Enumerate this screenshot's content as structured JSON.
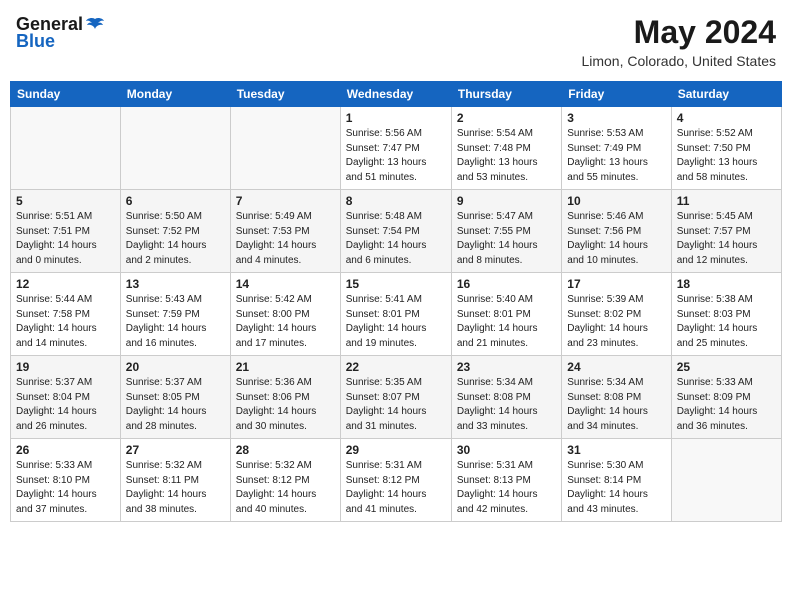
{
  "header": {
    "logo_general": "General",
    "logo_blue": "Blue",
    "title": "May 2024",
    "subtitle": "Limon, Colorado, United States"
  },
  "days_of_week": [
    "Sunday",
    "Monday",
    "Tuesday",
    "Wednesday",
    "Thursday",
    "Friday",
    "Saturday"
  ],
  "weeks": [
    [
      {
        "day": "",
        "info": ""
      },
      {
        "day": "",
        "info": ""
      },
      {
        "day": "",
        "info": ""
      },
      {
        "day": "1",
        "info": "Sunrise: 5:56 AM\nSunset: 7:47 PM\nDaylight: 13 hours\nand 51 minutes."
      },
      {
        "day": "2",
        "info": "Sunrise: 5:54 AM\nSunset: 7:48 PM\nDaylight: 13 hours\nand 53 minutes."
      },
      {
        "day": "3",
        "info": "Sunrise: 5:53 AM\nSunset: 7:49 PM\nDaylight: 13 hours\nand 55 minutes."
      },
      {
        "day": "4",
        "info": "Sunrise: 5:52 AM\nSunset: 7:50 PM\nDaylight: 13 hours\nand 58 minutes."
      }
    ],
    [
      {
        "day": "5",
        "info": "Sunrise: 5:51 AM\nSunset: 7:51 PM\nDaylight: 14 hours\nand 0 minutes."
      },
      {
        "day": "6",
        "info": "Sunrise: 5:50 AM\nSunset: 7:52 PM\nDaylight: 14 hours\nand 2 minutes."
      },
      {
        "day": "7",
        "info": "Sunrise: 5:49 AM\nSunset: 7:53 PM\nDaylight: 14 hours\nand 4 minutes."
      },
      {
        "day": "8",
        "info": "Sunrise: 5:48 AM\nSunset: 7:54 PM\nDaylight: 14 hours\nand 6 minutes."
      },
      {
        "day": "9",
        "info": "Sunrise: 5:47 AM\nSunset: 7:55 PM\nDaylight: 14 hours\nand 8 minutes."
      },
      {
        "day": "10",
        "info": "Sunrise: 5:46 AM\nSunset: 7:56 PM\nDaylight: 14 hours\nand 10 minutes."
      },
      {
        "day": "11",
        "info": "Sunrise: 5:45 AM\nSunset: 7:57 PM\nDaylight: 14 hours\nand 12 minutes."
      }
    ],
    [
      {
        "day": "12",
        "info": "Sunrise: 5:44 AM\nSunset: 7:58 PM\nDaylight: 14 hours\nand 14 minutes."
      },
      {
        "day": "13",
        "info": "Sunrise: 5:43 AM\nSunset: 7:59 PM\nDaylight: 14 hours\nand 16 minutes."
      },
      {
        "day": "14",
        "info": "Sunrise: 5:42 AM\nSunset: 8:00 PM\nDaylight: 14 hours\nand 17 minutes."
      },
      {
        "day": "15",
        "info": "Sunrise: 5:41 AM\nSunset: 8:01 PM\nDaylight: 14 hours\nand 19 minutes."
      },
      {
        "day": "16",
        "info": "Sunrise: 5:40 AM\nSunset: 8:01 PM\nDaylight: 14 hours\nand 21 minutes."
      },
      {
        "day": "17",
        "info": "Sunrise: 5:39 AM\nSunset: 8:02 PM\nDaylight: 14 hours\nand 23 minutes."
      },
      {
        "day": "18",
        "info": "Sunrise: 5:38 AM\nSunset: 8:03 PM\nDaylight: 14 hours\nand 25 minutes."
      }
    ],
    [
      {
        "day": "19",
        "info": "Sunrise: 5:37 AM\nSunset: 8:04 PM\nDaylight: 14 hours\nand 26 minutes."
      },
      {
        "day": "20",
        "info": "Sunrise: 5:37 AM\nSunset: 8:05 PM\nDaylight: 14 hours\nand 28 minutes."
      },
      {
        "day": "21",
        "info": "Sunrise: 5:36 AM\nSunset: 8:06 PM\nDaylight: 14 hours\nand 30 minutes."
      },
      {
        "day": "22",
        "info": "Sunrise: 5:35 AM\nSunset: 8:07 PM\nDaylight: 14 hours\nand 31 minutes."
      },
      {
        "day": "23",
        "info": "Sunrise: 5:34 AM\nSunset: 8:08 PM\nDaylight: 14 hours\nand 33 minutes."
      },
      {
        "day": "24",
        "info": "Sunrise: 5:34 AM\nSunset: 8:08 PM\nDaylight: 14 hours\nand 34 minutes."
      },
      {
        "day": "25",
        "info": "Sunrise: 5:33 AM\nSunset: 8:09 PM\nDaylight: 14 hours\nand 36 minutes."
      }
    ],
    [
      {
        "day": "26",
        "info": "Sunrise: 5:33 AM\nSunset: 8:10 PM\nDaylight: 14 hours\nand 37 minutes."
      },
      {
        "day": "27",
        "info": "Sunrise: 5:32 AM\nSunset: 8:11 PM\nDaylight: 14 hours\nand 38 minutes."
      },
      {
        "day": "28",
        "info": "Sunrise: 5:32 AM\nSunset: 8:12 PM\nDaylight: 14 hours\nand 40 minutes."
      },
      {
        "day": "29",
        "info": "Sunrise: 5:31 AM\nSunset: 8:12 PM\nDaylight: 14 hours\nand 41 minutes."
      },
      {
        "day": "30",
        "info": "Sunrise: 5:31 AM\nSunset: 8:13 PM\nDaylight: 14 hours\nand 42 minutes."
      },
      {
        "day": "31",
        "info": "Sunrise: 5:30 AM\nSunset: 8:14 PM\nDaylight: 14 hours\nand 43 minutes."
      },
      {
        "day": "",
        "info": ""
      }
    ]
  ]
}
